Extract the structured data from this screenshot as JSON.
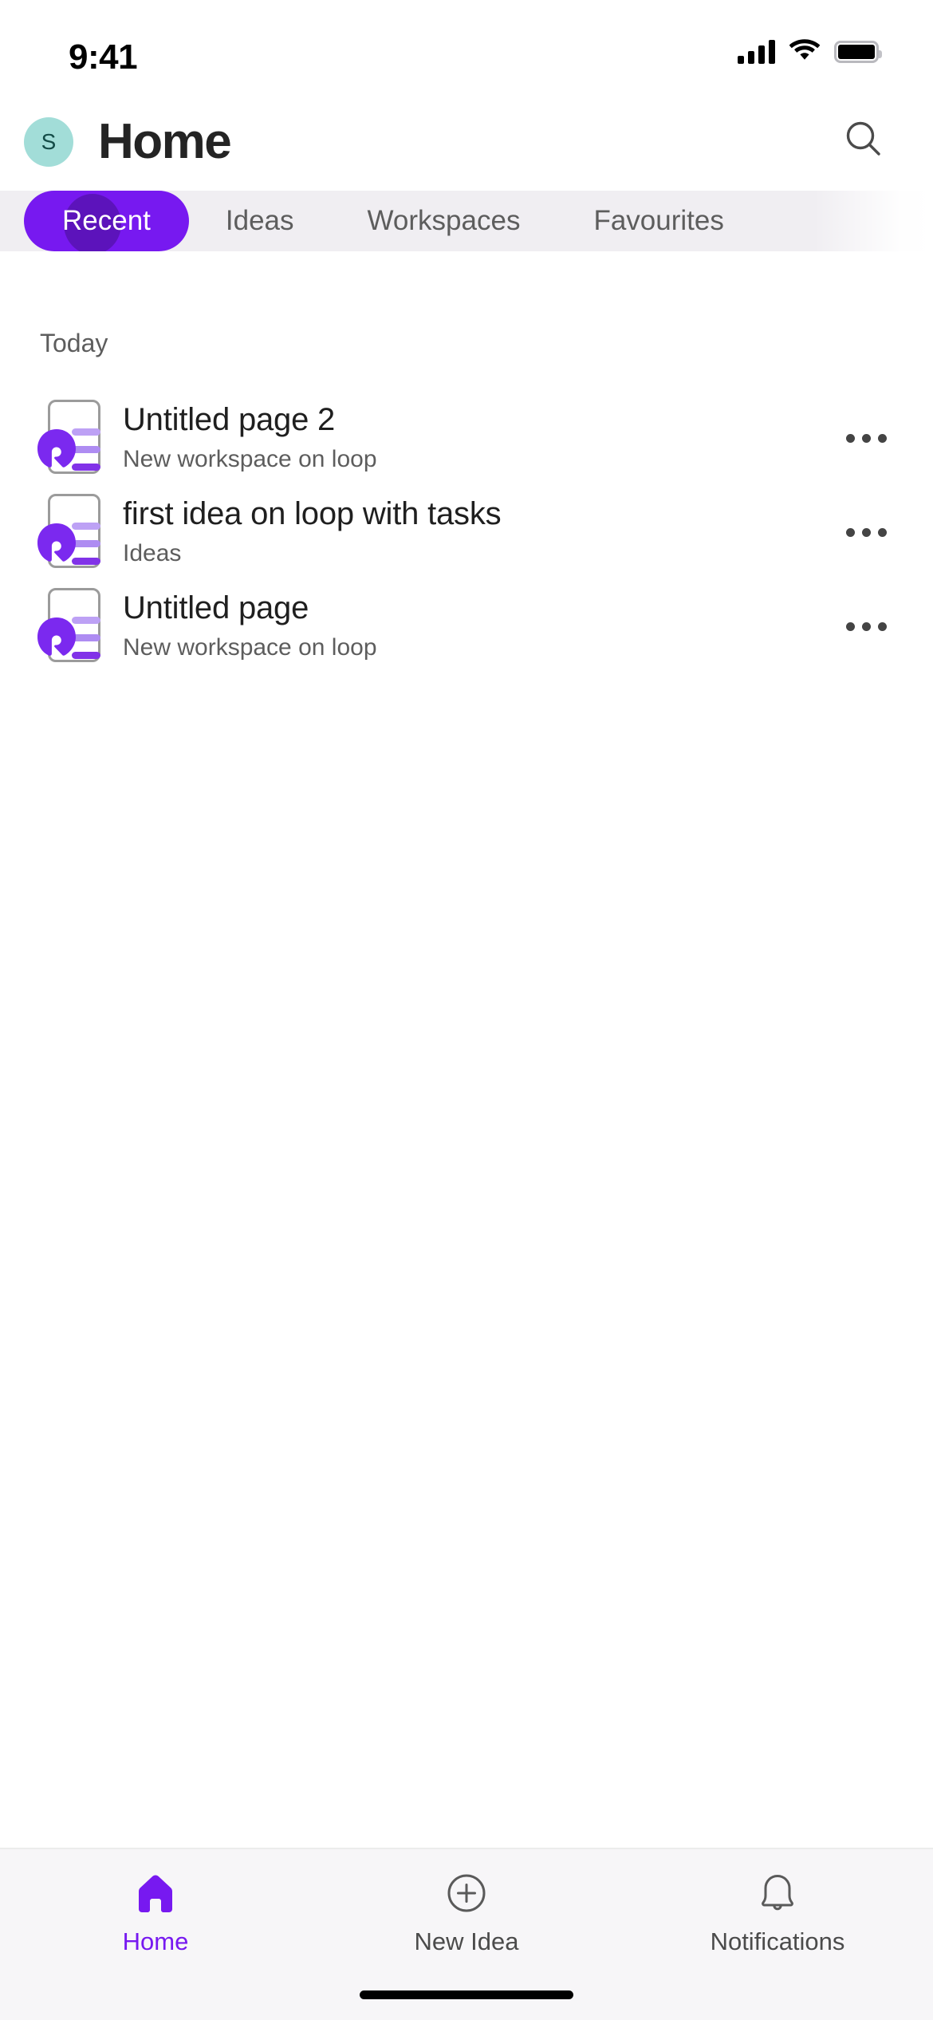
{
  "status_bar": {
    "time": "9:41",
    "signal_icon": "cellular-signal-icon",
    "wifi_icon": "wifi-icon",
    "battery_icon": "battery-full-icon"
  },
  "header": {
    "avatar_initial": "S",
    "avatar_bg": "#a2ddd8",
    "avatar_fg": "#134b47",
    "title": "Home",
    "search_icon": "search-icon"
  },
  "tabs": {
    "active_index": 0,
    "items": [
      {
        "label": "Recent"
      },
      {
        "label": "Ideas"
      },
      {
        "label": "Workspaces"
      },
      {
        "label": "Favourites"
      }
    ],
    "active_bg": "#7719f0",
    "active_fg": "#ffffff",
    "track_bg": "#f0eef2"
  },
  "content": {
    "section_label": "Today",
    "rows": [
      {
        "title": "Untitled page 2",
        "subtitle": "New workspace on loop",
        "icon": "loop-page-icon",
        "more_icon": "more-horizontal-icon"
      },
      {
        "title": "first idea on loop with tasks",
        "subtitle": "Ideas",
        "icon": "loop-page-icon",
        "more_icon": "more-horizontal-icon"
      },
      {
        "title": "Untitled page",
        "subtitle": "New workspace on loop",
        "icon": "loop-page-icon",
        "more_icon": "more-horizontal-icon"
      }
    ]
  },
  "bottom_nav": {
    "active_index": 0,
    "accent": "#7719f0",
    "items": [
      {
        "label": "Home",
        "icon": "home-icon"
      },
      {
        "label": "New Idea",
        "icon": "plus-circle-icon"
      },
      {
        "label": "Notifications",
        "icon": "bell-icon"
      }
    ]
  }
}
